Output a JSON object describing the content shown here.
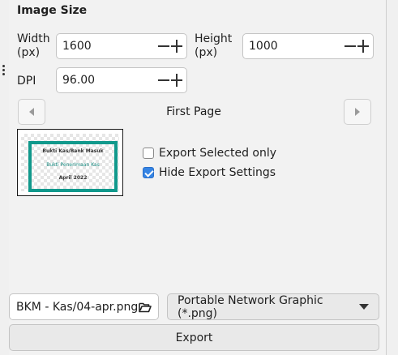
{
  "section": {
    "title": "Image Size"
  },
  "width": {
    "label_line1": "Width",
    "label_line2": "(px)",
    "value": "1600"
  },
  "height": {
    "label_line1": "Height",
    "label_line2": "(px)",
    "value": "1000"
  },
  "dpi": {
    "label": "DPI",
    "value": "96.00"
  },
  "pager": {
    "current_page": "First Page"
  },
  "preview": {
    "title": "Bukti Kas/Bank Masuk",
    "subtitle": "Bukti Penerimaan Kas",
    "date": "April 2022",
    "frame_color": "#11998c"
  },
  "options": {
    "export_selected_only": {
      "label": "Export Selected only",
      "checked": false
    },
    "hide_export_settings": {
      "label": "Hide Export Settings",
      "checked": true
    }
  },
  "file": {
    "name": "BKM - Kas/04-apr.png",
    "icon": "folder-open-icon"
  },
  "format": {
    "selected": "Portable Network Graphic (*.png)",
    "icon": "chevron-down-icon"
  },
  "actions": {
    "export_label": "Export"
  },
  "colors": {
    "accent": "#3584e4",
    "preview_frame": "#11998c"
  }
}
